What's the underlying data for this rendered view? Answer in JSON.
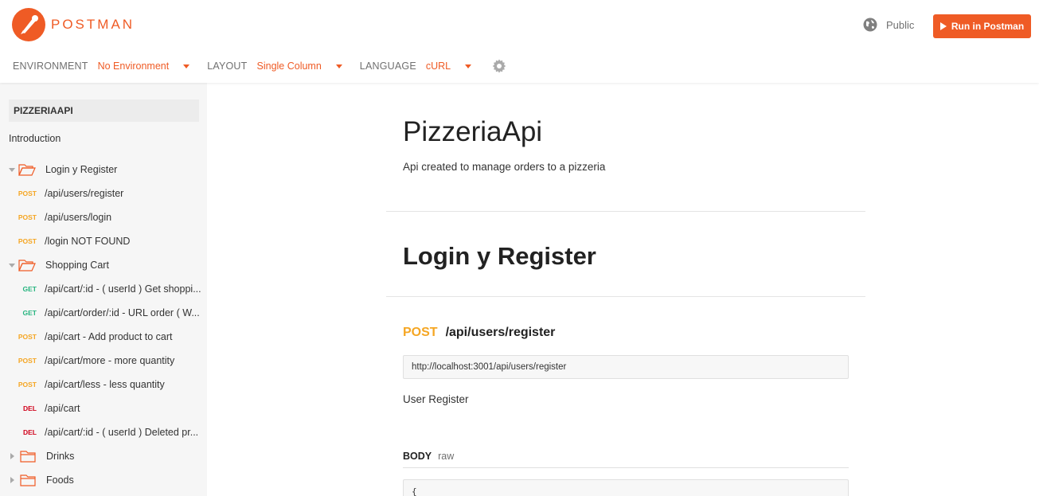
{
  "header": {
    "brand": "POSTMAN",
    "visibility": "Public",
    "run_button": "Run in Postman",
    "accent": "#ef5b25"
  },
  "toolbar": {
    "environment_label": "ENVIRONMENT",
    "environment_value": "No Environment",
    "layout_label": "LAYOUT",
    "layout_value": "Single Column",
    "language_label": "LANGUAGE",
    "language_value": "cURL",
    "settings_icon": "gear-icon"
  },
  "sidebar": {
    "collection": "PIZZERIAAPI",
    "introduction": "Introduction",
    "folders": [
      {
        "name": "Login y Register",
        "expanded": true,
        "requests": [
          {
            "method": "POST",
            "name": "/api/users/register"
          },
          {
            "method": "POST",
            "name": "/api/users/login"
          },
          {
            "method": "POST",
            "name": "/login NOT FOUND"
          }
        ]
      },
      {
        "name": "Shopping Cart",
        "expanded": true,
        "requests": [
          {
            "method": "GET",
            "name": "/api/cart/:id - ( userId ) Get shoppi..."
          },
          {
            "method": "GET",
            "name": "/api/cart/order/:id - URL order ( W..."
          },
          {
            "method": "POST",
            "name": "/api/cart - Add product to cart"
          },
          {
            "method": "POST",
            "name": "/api/cart/more - more quantity"
          },
          {
            "method": "POST",
            "name": "/api/cart/less - less quantity"
          },
          {
            "method": "DEL",
            "name": "/api/cart"
          },
          {
            "method": "DEL",
            "name": "/api/cart/:id - ( userId ) Deleted pr..."
          }
        ]
      },
      {
        "name": "Drinks",
        "expanded": false,
        "requests": []
      },
      {
        "name": "Foods",
        "expanded": false,
        "requests": []
      }
    ]
  },
  "main": {
    "title": "PizzeriaApi",
    "description": "Api created to manage orders to a pizzeria",
    "folder_title": "Login y Register",
    "request": {
      "method": "POST",
      "path": "/api/users/register",
      "url": "http://localhost:3001/api/users/register",
      "description": "User Register",
      "body_label": "BODY",
      "body_mode": "raw",
      "body_preview": "{"
    }
  }
}
